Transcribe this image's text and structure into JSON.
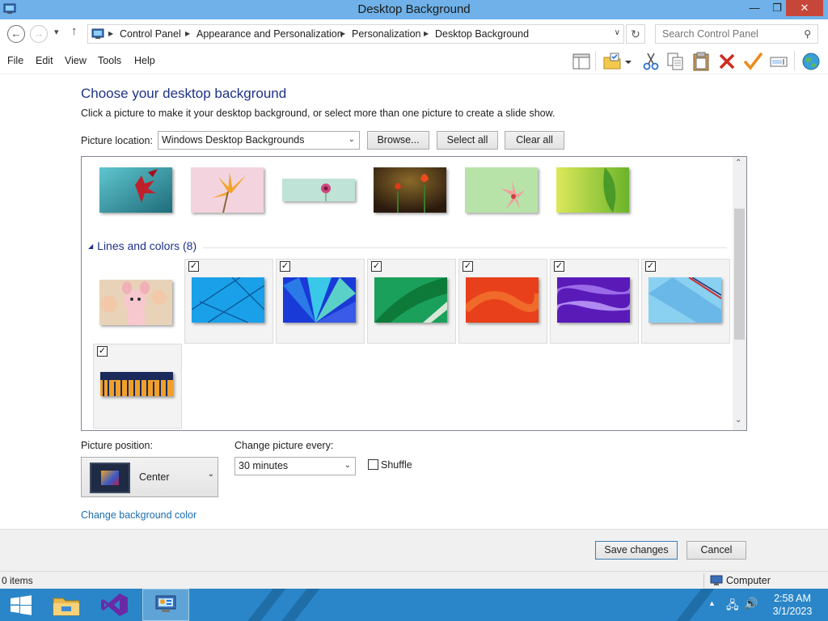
{
  "window": {
    "title": "Desktop Background",
    "minimize_glyph": "—",
    "maximize_glyph": "❐",
    "close_glyph": "✕"
  },
  "nav": {
    "back_glyph": "←",
    "forward_glyph": "→",
    "history_glyph": "▾",
    "up_glyph": "↑"
  },
  "address": {
    "crumbs": [
      "Control Panel",
      "Appearance and Personalization",
      "Personalization",
      "Desktop Background"
    ],
    "separator": "▶",
    "dropdown_glyph": "∨",
    "refresh_glyph": "↻"
  },
  "search": {
    "placeholder": "Search Control Panel",
    "icon": "search-icon",
    "icon_glyph": "⚲"
  },
  "menu": [
    "File",
    "Edit",
    "View",
    "Tools",
    "Help"
  ],
  "toolbar": [
    "layout-pane-icon",
    "folder-options-icon",
    "cut-icon",
    "copy-icon",
    "paste-icon",
    "delete-icon",
    "properties-check-icon",
    "rename-icon",
    "globe-icon"
  ],
  "page": {
    "heading": "Choose your desktop background",
    "subtitle": "Click a picture to make it your desktop background, or select more than one picture to create a slide show.",
    "picture_location_label": "Picture location:",
    "picture_location_value": "Windows Desktop Backgrounds",
    "browse_label": "Browse...",
    "select_all_label": "Select all",
    "clear_all_label": "Clear all",
    "dropdown_glyph": "⌄"
  },
  "gallery": {
    "flowers_row": [
      {
        "name": "red-flower-teal",
        "checked": false
      },
      {
        "name": "orange-flower-pink",
        "checked": false
      },
      {
        "name": "pink-flower-mint",
        "checked": false
      },
      {
        "name": "red-tulips-dark",
        "checked": false
      },
      {
        "name": "pink-flower-green",
        "checked": false
      },
      {
        "name": "green-leaf",
        "checked": false
      }
    ],
    "group": {
      "title": "Lines and colors (8)",
      "collapse_glyph": "◢",
      "check_glyph": "✓",
      "items": [
        {
          "name": "cartoon-character",
          "checked": false
        },
        {
          "name": "blue-lines",
          "checked": true
        },
        {
          "name": "blue-fan",
          "checked": true
        },
        {
          "name": "green-sweep",
          "checked": true
        },
        {
          "name": "orange-swirl",
          "checked": true
        },
        {
          "name": "purple-waves",
          "checked": true
        },
        {
          "name": "light-blue-lines",
          "checked": true
        },
        {
          "name": "city-skyline",
          "checked": true
        }
      ]
    },
    "scroll_up_glyph": "⌃",
    "scroll_down_glyph": "⌄"
  },
  "options": {
    "picture_position_label": "Picture position:",
    "picture_position_value": "Center",
    "change_every_label": "Change picture every:",
    "change_every_value": "30 minutes",
    "shuffle_label": "Shuffle",
    "shuffle_checked": false,
    "background_color_link": "Change background color"
  },
  "actions": {
    "save_label": "Save changes",
    "cancel_label": "Cancel"
  },
  "statusbar": {
    "items": "0 items",
    "location": "Computer"
  },
  "taskbar": {
    "apps": [
      "start-icon",
      "file-explorer-icon",
      "visual-studio-icon",
      "control-panel-icon"
    ],
    "tray": [
      "show-hidden-icons",
      "network-icon",
      "volume-icon"
    ],
    "tray_up_glyph": "▲",
    "network_glyph": "🖧",
    "volume_glyph": "🔊",
    "time": "2:58 AM",
    "date": "3/1/2023"
  },
  "colors": {
    "titlebar": "#6fb1e8",
    "heading": "#1e3287",
    "link": "#1b6dae",
    "taskbar": "#2a86c8"
  }
}
